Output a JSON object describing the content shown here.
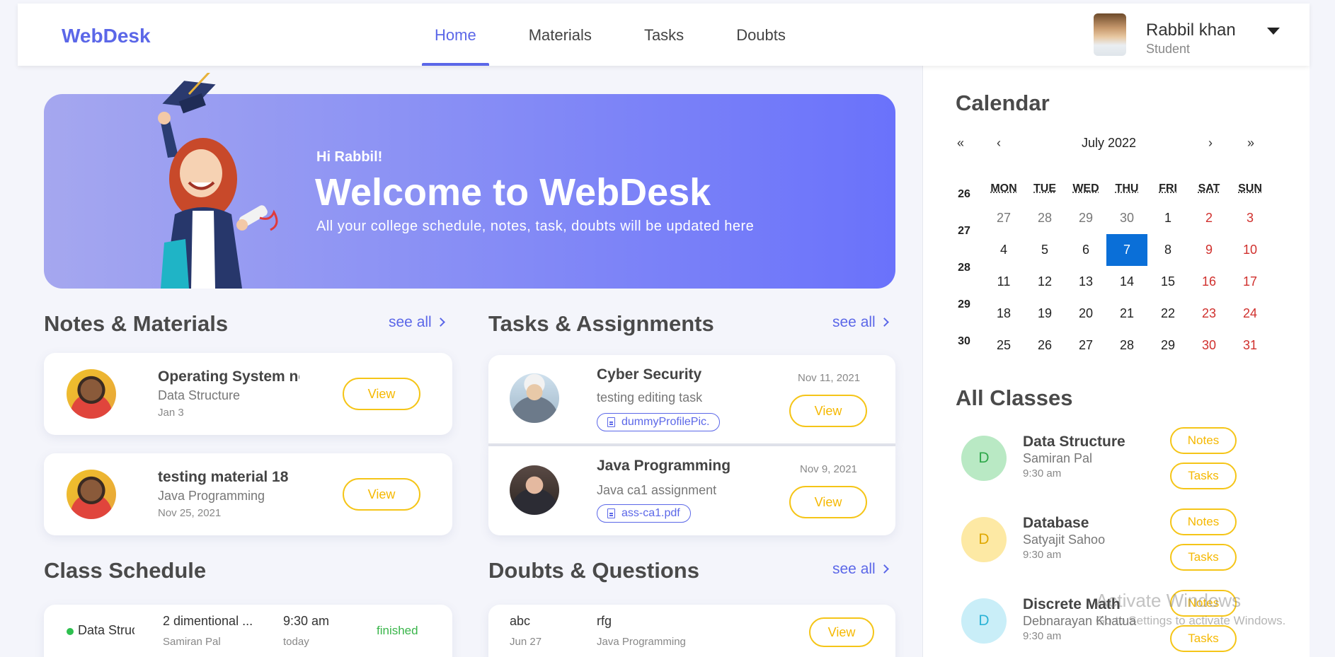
{
  "brand": "WebDesk",
  "nav": {
    "items": [
      "Home",
      "Materials",
      "Tasks",
      "Doubts"
    ],
    "active": "Home"
  },
  "user": {
    "name": "Rabbil khan",
    "role": "Student"
  },
  "banner": {
    "greeting": "Hi Rabbil!",
    "title": "Welcome to WebDesk",
    "subtitle": "All your college schedule, notes, task, doubts will be updated here"
  },
  "notes": {
    "title": "Notes & Materials",
    "see_all": "see all",
    "items": [
      {
        "title": "Operating System nc",
        "subject": "Data Structure",
        "date": "Jan 3",
        "button": "View"
      },
      {
        "title": "testing material 18",
        "subject": "Java Programming",
        "date": "Nov 25, 2021",
        "button": "View"
      }
    ]
  },
  "tasks": {
    "title": "Tasks & Assignments",
    "see_all": "see all",
    "items": [
      {
        "title": "Cyber Security",
        "desc": "testing editing task",
        "file": "dummyProfilePic.",
        "date": "Nov 11, 2021",
        "button": "View"
      },
      {
        "title": "Java Programming",
        "desc": "Java ca1 assignment",
        "file": "ass-ca1.pdf",
        "date": "Nov 9, 2021",
        "button": "View"
      }
    ]
  },
  "schedule": {
    "title": "Class Schedule",
    "row": {
      "subject": "Data Struc",
      "topic": "2 dimentional ...",
      "teacher": "Samiran Pal",
      "time": "9:30 am",
      "day": "today",
      "status": "finished"
    }
  },
  "doubts": {
    "title": "Doubts & Questions",
    "see_all": "see all",
    "row": {
      "user": "abc",
      "date": "Jun 27",
      "question": "rfg",
      "subject": "Java Programming",
      "button": "View"
    }
  },
  "calendar": {
    "title": "Calendar",
    "month": "July 2022",
    "nav": {
      "first": "«",
      "prev": "‹",
      "next": "›",
      "last": "»"
    },
    "weekdays": [
      "MON",
      "TUE",
      "WED",
      "THU",
      "FRI",
      "SAT",
      "SUN"
    ],
    "weeks": [
      "26",
      "27",
      "28",
      "29",
      "30"
    ],
    "days": [
      [
        "27",
        "28",
        "29",
        "30",
        "1",
        "2",
        "3"
      ],
      [
        "4",
        "5",
        "6",
        "7",
        "8",
        "9",
        "10"
      ],
      [
        "11",
        "12",
        "13",
        "14",
        "15",
        "16",
        "17"
      ],
      [
        "18",
        "19",
        "20",
        "21",
        "22",
        "23",
        "24"
      ],
      [
        "25",
        "26",
        "27",
        "28",
        "29",
        "30",
        "31"
      ]
    ],
    "selected": "7",
    "accent": "#0a6fd8",
    "weekend_color": "#d0302d"
  },
  "classes": {
    "title": "All Classes",
    "items": [
      {
        "badge": "D",
        "name": "Data Structure",
        "teacher": "Samiran Pal",
        "time": "9:30 am",
        "color": "#b9e9c4",
        "text_color": "#2ea84a"
      },
      {
        "badge": "D",
        "name": "Database",
        "teacher": "Satyajit Sahoo",
        "time": "9:30 am",
        "color": "#fde9a4",
        "text_color": "#e0a800"
      },
      {
        "badge": "D",
        "name": "Discrete Math",
        "teacher": "Debnarayan Khatua",
        "time": "9:30 am",
        "color": "#c9eef8",
        "text_color": "#2cb3d6"
      }
    ],
    "notes_label": "Notes",
    "tasks_label": "Tasks"
  },
  "watermark": {
    "line1": "Activate Windows",
    "line2": "Go to Settings to activate Windows."
  },
  "colors": {
    "primary": "#5b67e8",
    "button_yellow": "#f5c518",
    "status_green": "#39b54a"
  }
}
